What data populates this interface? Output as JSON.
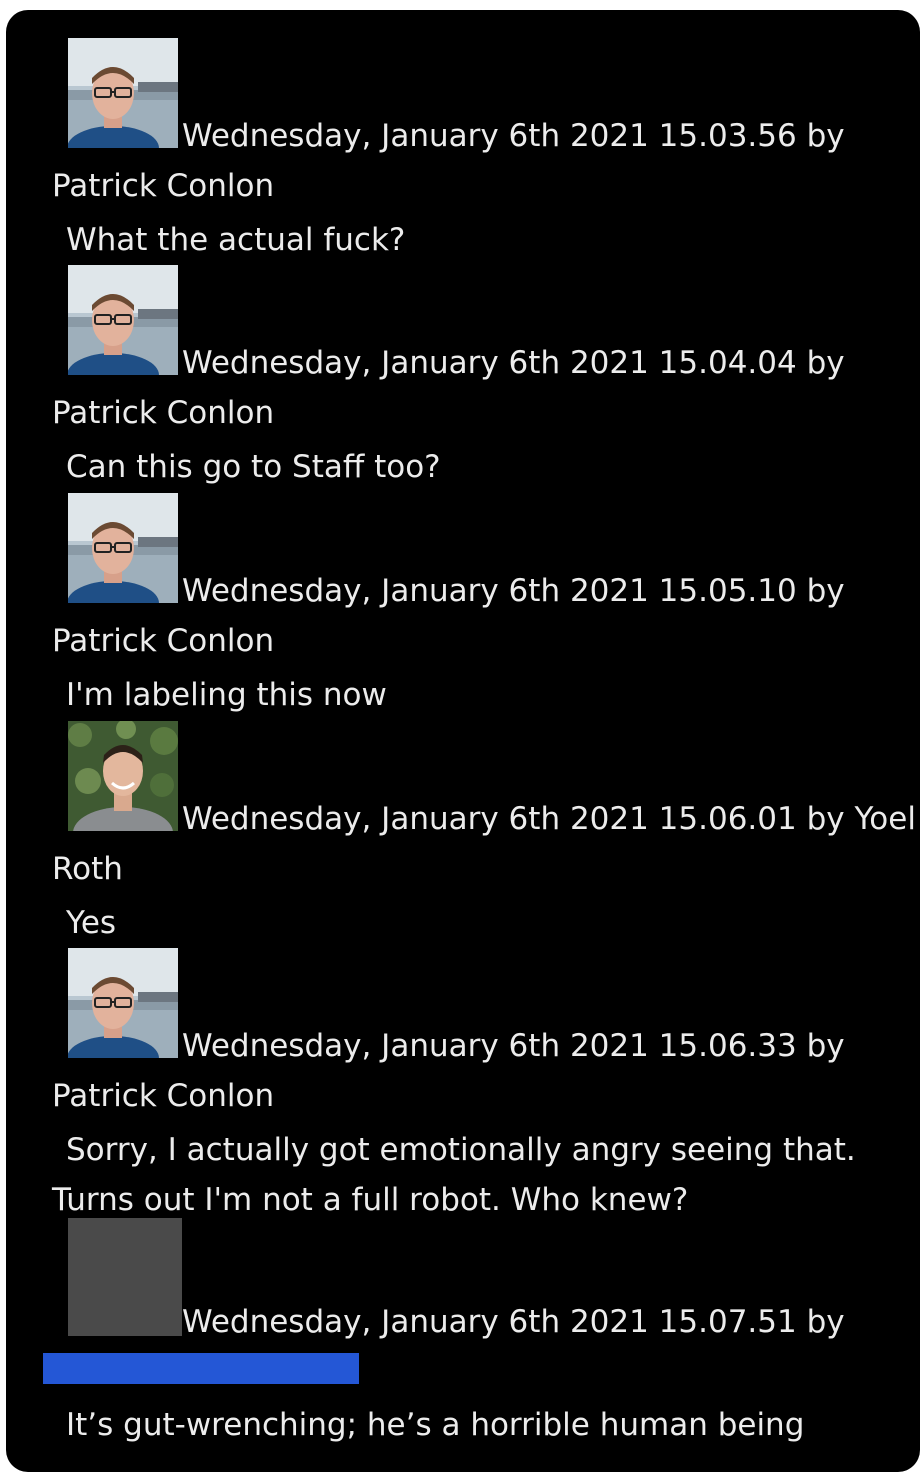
{
  "messages": [
    {
      "avatar": "patrick-conlon-photo",
      "meta": "Wednesday, January 6th 2021 15.03.56 by",
      "author": "Patrick Conlon",
      "text": "What the actual fuck?"
    },
    {
      "avatar": "patrick-conlon-photo",
      "meta": "Wednesday, January 6th 2021 15.04.04 by",
      "author": "Patrick Conlon",
      "text": "Can this go to Staff too?"
    },
    {
      "avatar": "patrick-conlon-photo",
      "meta": "Wednesday, January 6th 2021 15.05.10 by",
      "author": "Patrick Conlon",
      "text": "I'm labeling this now"
    },
    {
      "avatar": "yoel-roth-photo",
      "meta": "Wednesday, January 6th 2021 15.06.01 by Yoel",
      "author": "Roth",
      "text": "Yes"
    },
    {
      "avatar": "patrick-conlon-photo",
      "meta": "Wednesday, January 6th 2021 15.06.33 by",
      "author": "Patrick Conlon",
      "text": "Sorry, I actually got emotionally angry seeing that. Turns out I'm not a full robot. Who knew?"
    },
    {
      "avatar": "redacted-gray-box",
      "meta": "Wednesday, January 6th 2021 15.07.51 by",
      "author": "",
      "text": "It’s gut-wrenching; he’s a horrible human being"
    }
  ],
  "colors": {
    "background": "#000000",
    "text": "#ececec",
    "redaction_bar": "#2457d6",
    "redaction_avatar": "#4a4a4a"
  }
}
